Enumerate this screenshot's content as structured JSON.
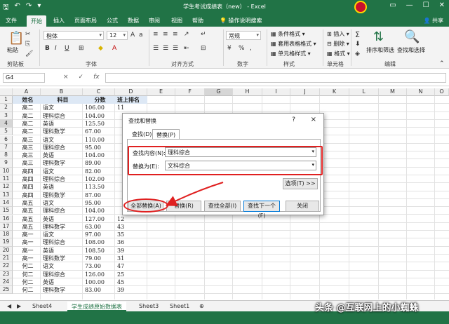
{
  "window": {
    "title": "学生考试成绩表（new） - Excel"
  },
  "tabs": [
    "文件",
    "开始",
    "插入",
    "页面布局",
    "公式",
    "数据",
    "审阅",
    "视图",
    "帮助"
  ],
  "active_tab": "开始",
  "tell_me": "操作说明搜索",
  "share": "共享",
  "ribbon": {
    "clipboard": {
      "paste": "粘贴",
      "label": "剪贴板"
    },
    "font": {
      "name": "楷体",
      "size": "12",
      "label": "字体"
    },
    "alignment": {
      "label": "对齐方式"
    },
    "number": {
      "format": "常规",
      "label": "数字"
    },
    "styles": {
      "cond": "条件格式",
      "table": "套用表格格式",
      "cell": "单元格样式",
      "label": "样式"
    },
    "cells": {
      "insert": "插入",
      "delete": "删除",
      "format": "格式",
      "label": "单元格"
    },
    "editing": {
      "sort": "排序和筛选",
      "find": "查找和选择",
      "label": "编辑"
    }
  },
  "formula_bar": {
    "name_box": "G4",
    "fx": "fx",
    "cancel": "×",
    "enter": "✓"
  },
  "columns": [
    "A",
    "B",
    "C",
    "D",
    "E",
    "F",
    "G",
    "H",
    "I",
    "J",
    "K",
    "L",
    "M",
    "N",
    "O"
  ],
  "header_row": [
    "姓名",
    "科目",
    "分数",
    "班上排名"
  ],
  "rows": [
    [
      "高二",
      "语文",
      "106.00",
      "11"
    ],
    [
      "高二",
      "理科综合",
      "104.00",
      ""
    ],
    [
      "高二",
      "英语",
      "125.50",
      ""
    ],
    [
      "高二",
      "理科数学",
      "67.00",
      ""
    ],
    [
      "高三",
      "语文",
      "110.00",
      ""
    ],
    [
      "高三",
      "理科综合",
      "95.00",
      ""
    ],
    [
      "高三",
      "英语",
      "104.00",
      ""
    ],
    [
      "高三",
      "理科数学",
      "89.00",
      ""
    ],
    [
      "高四",
      "语文",
      "82.00",
      ""
    ],
    [
      "高四",
      "理科综合",
      "102.00",
      ""
    ],
    [
      "高四",
      "英语",
      "113.50",
      ""
    ],
    [
      "高四",
      "理科数学",
      "87.00",
      ""
    ],
    [
      "高五",
      "语文",
      "95.00",
      ""
    ],
    [
      "高五",
      "理科综合",
      "104.00",
      ""
    ],
    [
      "高五",
      "英语",
      "127.00",
      "12"
    ],
    [
      "高五",
      "理科数学",
      "63.00",
      "43"
    ],
    [
      "高一",
      "语文",
      "97.00",
      "35"
    ],
    [
      "高一",
      "理科综合",
      "108.00",
      "36"
    ],
    [
      "高一",
      "英语",
      "108.50",
      "39"
    ],
    [
      "高一",
      "理科数学",
      "79.00",
      "31"
    ],
    [
      "何二",
      "语文",
      "73.00",
      "47"
    ],
    [
      "何二",
      "理科综合",
      "126.00",
      "25"
    ],
    [
      "何二",
      "英语",
      "100.00",
      "45"
    ],
    [
      "何二",
      "理科数学",
      "83.00",
      "39"
    ]
  ],
  "row_numbers": [
    "1",
    "2",
    "3",
    "4",
    "5",
    "6",
    "7",
    "8",
    "9",
    "10",
    "11",
    "12",
    "13",
    "14",
    "15",
    "16",
    "17",
    "18",
    "19",
    "20",
    "21",
    "22",
    "23",
    "24",
    "25"
  ],
  "sheets": [
    "Sheet4",
    "学生成绩原始数据表",
    "Sheet3",
    "Sheet1"
  ],
  "active_sheet": "学生成绩原始数据表",
  "dialog": {
    "title": "查找和替换",
    "help": "?",
    "close": "×",
    "tabs": [
      "查找(D)",
      "替换(P)"
    ],
    "find_label": "查找内容(N):",
    "find_value": "理科综合",
    "replace_label": "替换为(E):",
    "replace_value": "文科综合",
    "options": "选项(T) >>",
    "buttons": [
      "全部替换(A)",
      "替换(R)",
      "查找全部(I)",
      "查找下一个(F)",
      "关闭"
    ]
  },
  "watermark": "头条 @互联网上的小蜘蛛",
  "colors": {
    "accent": "#217346",
    "highlight": "#e02020"
  }
}
